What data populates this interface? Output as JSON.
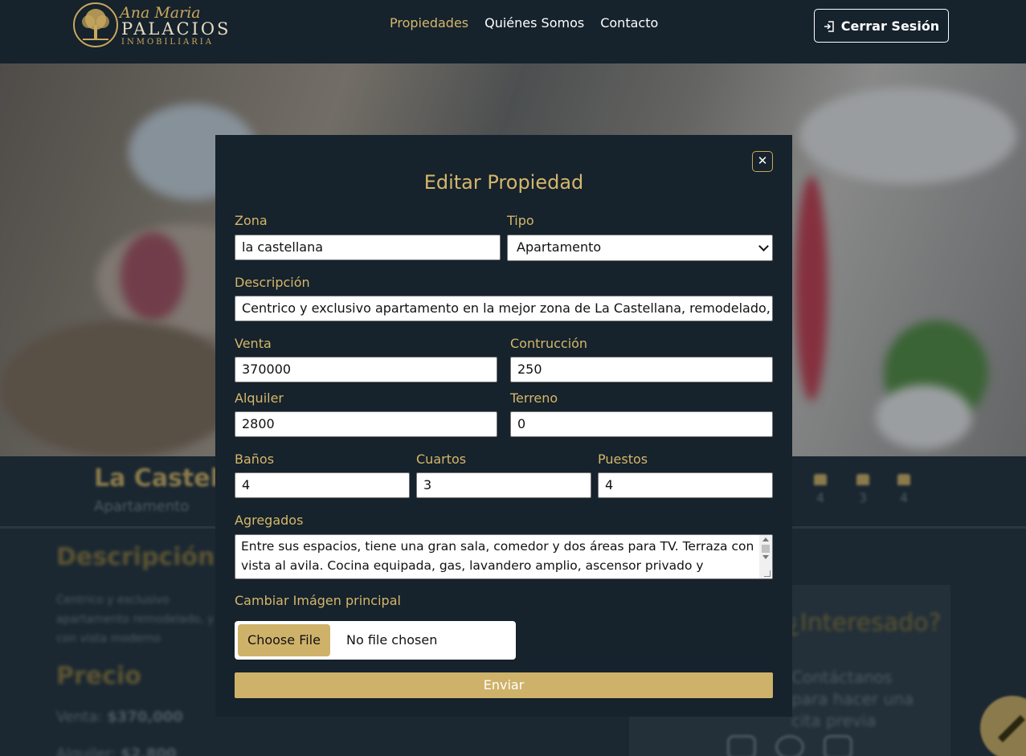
{
  "brand": {
    "script": "Ana Maria",
    "name": "PALACIOS",
    "sub": "INMOBILIARIA"
  },
  "nav": {
    "items": [
      {
        "label": "Propiedades",
        "active": true
      },
      {
        "label": "Quiénes Somos",
        "active": false
      },
      {
        "label": "Contacto",
        "active": false
      }
    ],
    "logout_label": "Cerrar Sesión"
  },
  "colors": {
    "gold": "#d4b76a",
    "navy": "#16222c"
  },
  "modal": {
    "title": "Editar Propiedad",
    "close_icon": "close-icon",
    "fields": {
      "zona": {
        "label": "Zona",
        "value": "la castellana"
      },
      "tipo": {
        "label": "Tipo",
        "value": "Apartamento"
      },
      "descripcion": {
        "label": "Descripción",
        "value": "Centrico y exclusivo apartamento en la mejor zona de La Castellana, remodelado, y con vista al avila"
      },
      "venta": {
        "label": "Venta",
        "value": "370000"
      },
      "construccion": {
        "label": "Contrucción",
        "value": "250"
      },
      "alquiler": {
        "label": "Alquiler",
        "value": "2800"
      },
      "terreno": {
        "label": "Terreno",
        "value": "0"
      },
      "banos": {
        "label": "Baños",
        "value": "4"
      },
      "cuartos": {
        "label": "Cuartos",
        "value": "3"
      },
      "puestos": {
        "label": "Puestos",
        "value": "4"
      },
      "agregados": {
        "label": "Agregados",
        "value": "Entre sus espacios,  tiene una gran sala, comedor y dos áreas para TV. Terraza con vista al avila. Cocina equipada, gas, lavandero amplio, ascensor privado y"
      },
      "imagen": {
        "label": "Cambiar Imágen principal",
        "button": "Choose File",
        "status": "No file chosen"
      }
    },
    "submit_label": "Enviar"
  }
}
